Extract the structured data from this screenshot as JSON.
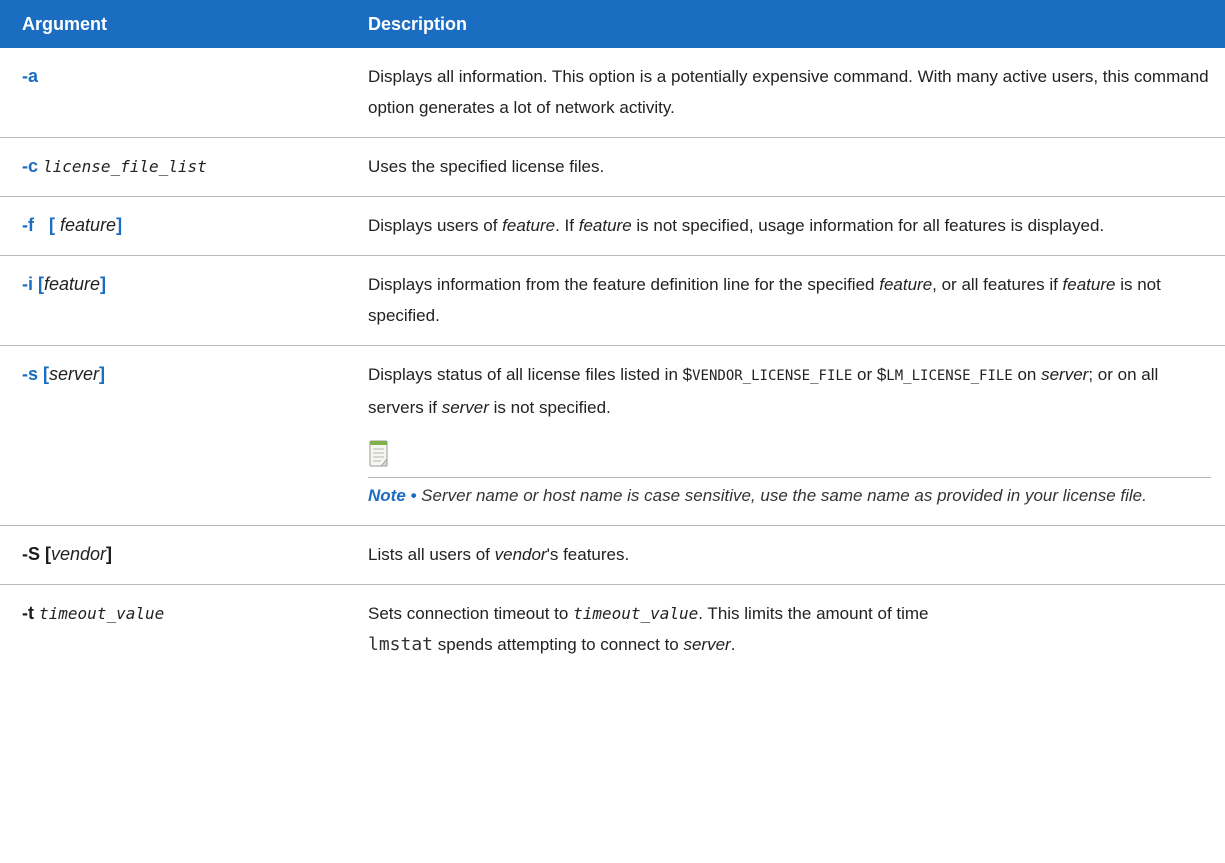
{
  "header": {
    "argument": "Argument",
    "description": "Description"
  },
  "rows": {
    "a": {
      "flag": "-a",
      "desc": "Displays all information. This option is a potentially expensive command. With many active users, this command option generates a lot of network activity."
    },
    "c": {
      "flag": "-c",
      "param": "license_file_list",
      "desc": "Uses the specified license files."
    },
    "f": {
      "flag": "-f",
      "open": "[",
      "param": "feature",
      "close": "]",
      "d1": "Displays users of ",
      "d2": "feature",
      "d3": ". If ",
      "d4": "feature",
      "d5": " is not specified, usage information for all features is displayed."
    },
    "i": {
      "flag": "-i [",
      "param": "feature",
      "close": "]",
      "d1": "Displays information from the feature definition line for the specified ",
      "d2": "feature",
      "d3": ", or all features if ",
      "d4": "feature",
      "d5": " is not specified."
    },
    "s": {
      "flag": "-s [",
      "param": "server",
      "close": "]",
      "d1": "Displays status of all license files listed in ",
      "v1": "$",
      "v1b": "VENDOR_LICENSE_FILE",
      "d2": " or ",
      "v2": "$",
      "v2b": "LM_LICENSE_FILE",
      "d3": " on ",
      "d4": "server",
      "d5": "; or on all servers if ",
      "d6": "server",
      "d7": " is not specified.",
      "note_label": "Note •",
      "note_text": " Server name or host name is case sensitive, use the same name as provided in your license file."
    },
    "S": {
      "flag": "-S [",
      "param": "vendor",
      "close": "]",
      "d1": "Lists all users of ",
      "d2": "vendor",
      "d3": "'s features."
    },
    "t": {
      "flag": "-t",
      "param": "timeout_value",
      "d1": "Sets connection timeout to ",
      "d2": "timeout_value",
      "d3": ". This limits the amount of time ",
      "d4": "lmstat",
      "d5": " spends attempting to connect to ",
      "d6": "server",
      "d7": "."
    }
  },
  "colors": {
    "header_bg": "#1a6dc0",
    "flag_blue": "#1a6dc0",
    "rule": "#b9b9b9"
  },
  "icons": {
    "note": "note-pad-icon"
  }
}
